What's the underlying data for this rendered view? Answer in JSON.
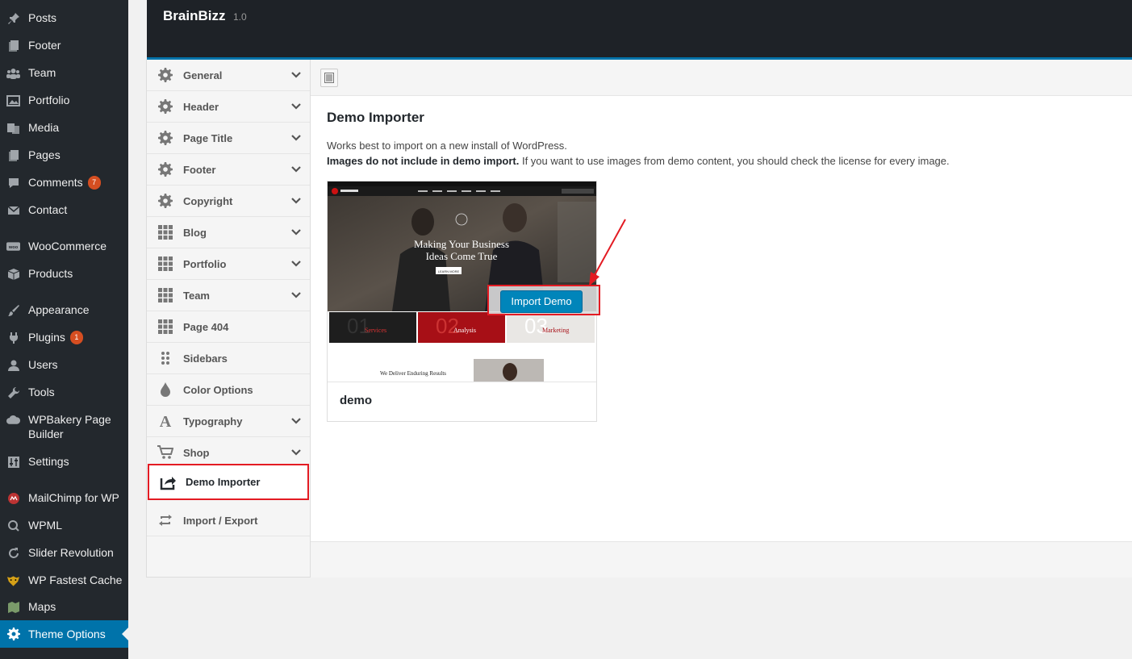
{
  "admin_menu": {
    "items": [
      {
        "label": "Posts",
        "icon": "pin-icon"
      },
      {
        "label": "Footer",
        "icon": "pages-icon"
      },
      {
        "label": "Team",
        "icon": "groups-icon"
      },
      {
        "label": "Portfolio",
        "icon": "portfolio-icon"
      },
      {
        "label": "Media",
        "icon": "media-icon"
      },
      {
        "label": "Pages",
        "icon": "pages-icon"
      },
      {
        "label": "Comments",
        "icon": "comment-icon",
        "badge": "7"
      },
      {
        "label": "Contact",
        "icon": "mail-icon"
      },
      {
        "label": "WooCommerce",
        "icon": "woo-icon"
      },
      {
        "label": "Products",
        "icon": "box-icon"
      },
      {
        "label": "Appearance",
        "icon": "brush-icon"
      },
      {
        "label": "Plugins",
        "icon": "plugin-icon",
        "badge": "1"
      },
      {
        "label": "Users",
        "icon": "user-icon"
      },
      {
        "label": "Tools",
        "icon": "wrench-icon"
      },
      {
        "label": "WPBakery Page Builder",
        "icon": "cloud-icon"
      },
      {
        "label": "Settings",
        "icon": "settings-sliders-icon"
      },
      {
        "label": "MailChimp for WP",
        "icon": "mailchimp-icon"
      },
      {
        "label": "WPML",
        "icon": "wpml-icon"
      },
      {
        "label": "Slider Revolution",
        "icon": "refresh-icon"
      },
      {
        "label": "WP Fastest Cache",
        "icon": "cheetah-icon"
      },
      {
        "label": "Maps",
        "icon": "map-icon"
      },
      {
        "label": "Theme Options",
        "icon": "gear-icon",
        "active": true
      }
    ]
  },
  "theme_header": {
    "name": "BrainBizz",
    "version": "1.0"
  },
  "options_nav": {
    "items": [
      {
        "label": "General",
        "icon": "gear-icon",
        "chevron": true
      },
      {
        "label": "Header",
        "icon": "gear-icon",
        "chevron": true
      },
      {
        "label": "Page Title",
        "icon": "gear-icon",
        "chevron": true
      },
      {
        "label": "Footer",
        "icon": "gear-icon",
        "chevron": true
      },
      {
        "label": "Copyright",
        "icon": "gear-icon",
        "chevron": true
      },
      {
        "label": "Blog",
        "icon": "grid-icon",
        "chevron": true
      },
      {
        "label": "Portfolio",
        "icon": "grid-icon",
        "chevron": true
      },
      {
        "label": "Team",
        "icon": "grid-icon",
        "chevron": true
      },
      {
        "label": "Page 404",
        "icon": "grid-icon",
        "chevron": false
      },
      {
        "label": "Sidebars",
        "icon": "dots-icon",
        "chevron": false
      },
      {
        "label": "Color Options",
        "icon": "drop-icon",
        "chevron": false
      },
      {
        "label": "Typography",
        "icon": "font-icon",
        "chevron": true
      },
      {
        "label": "Shop",
        "icon": "cart-icon",
        "chevron": true
      },
      {
        "label": "Demo Importer",
        "icon": "export-icon",
        "chevron": false,
        "active": true
      },
      {
        "label": "Import / Export",
        "icon": "transfer-icon",
        "chevron": false
      }
    ]
  },
  "content": {
    "title": "Demo Importer",
    "desc_line1": "Works best to import on a new install of WordPress.",
    "desc_bold": "Images do not include in demo import.",
    "desc_rest": " If you want to use images from demo content, you should check the license for every image.",
    "demo": {
      "name": "demo",
      "import_label": "Import Demo",
      "preview": {
        "hero_line1": "Making Your Business",
        "hero_line2": "Ideas Come True",
        "hero_button": "LEARN MORE",
        "tiles": [
          "Services",
          "Analysis",
          "Marketing"
        ],
        "tagline": "We Deliver Enduring Results"
      }
    }
  },
  "colors": {
    "wp_blue": "#0073aa",
    "highlight_red": "#e31b23",
    "sidebar_bg": "#23282d"
  }
}
